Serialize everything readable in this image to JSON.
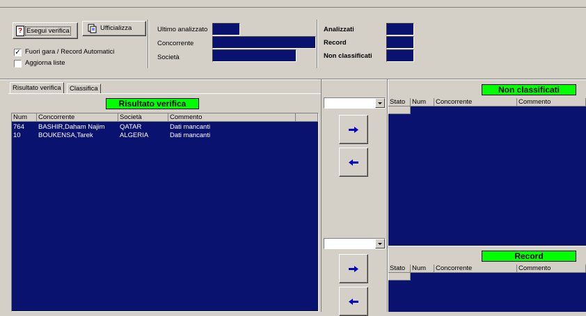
{
  "toolbar": {
    "esegui_label": "Esegui verifica",
    "ufficializza_label": "Ufficializza",
    "fuori_gara_label": "Fuori gara / Record Automatici",
    "fuori_gara_checked": true,
    "aggiorna_label": "Aggiorna liste",
    "aggiorna_checked": false
  },
  "info": {
    "ultimo_label": "Ultimo analizzato",
    "concorrente_label": "Concorrente",
    "societa_label": "Società"
  },
  "stats": {
    "analizzati_label": "Analizzati",
    "record_label": "Record",
    "non_classificati_label": "Non classificati"
  },
  "left_panel": {
    "tabs": [
      "Risultato verifica",
      "Classifica"
    ],
    "active_tab": 0,
    "title": "Risultato verifica",
    "columns": [
      "Num",
      "Concorrente",
      "Società",
      "Commento"
    ],
    "rows": [
      {
        "num": "764",
        "concorrente": "BASHIR,Daham Najim",
        "societa": "QATAR",
        "commento": "Dati mancanti"
      },
      {
        "num": "10",
        "concorrente": "BOUKENSA,Tarek",
        "societa": "ALGERIA",
        "commento": "Dati mancanti"
      }
    ]
  },
  "right_top": {
    "title": "Non classificati",
    "columns": [
      "Stato",
      "Num",
      "Concorrente",
      "Commento"
    ]
  },
  "right_bottom": {
    "title": "Record",
    "columns": [
      "Stato",
      "Num",
      "Concorrente",
      "Commento"
    ]
  },
  "colors": {
    "navy": "#0a1270",
    "green": "#00ff00",
    "face": "#d4d0c8"
  }
}
